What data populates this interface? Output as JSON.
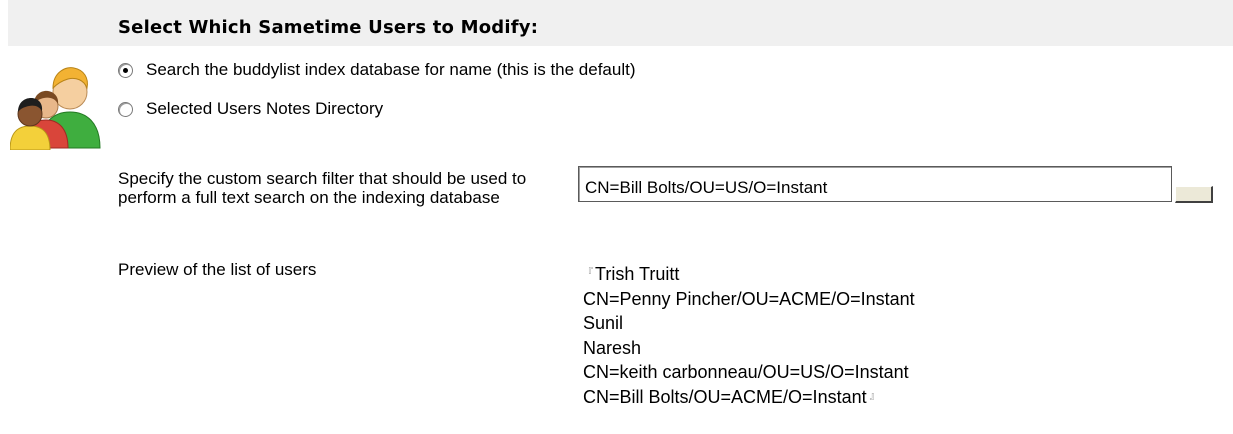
{
  "header": {
    "title": "Select Which Sametime Users to Modify:"
  },
  "radio_group": {
    "options": [
      {
        "label": "Search the buddylist index database for name (this is the default)",
        "checked": true
      },
      {
        "label": "Selected Users Notes Directory",
        "checked": false
      }
    ]
  },
  "filter": {
    "label": "Specify the custom search filter that should be used to perform a full text search on the indexing database",
    "value": "CN=Bill Bolts/OU=US/O=Instant"
  },
  "preview": {
    "label": "Preview of the list of users",
    "users": [
      "Trish Truitt",
      "CN=Penny Pincher/OU=ACME/O=Instant",
      "Sunil",
      "Naresh",
      "CN=keith carbonneau/OU=US/O=Instant",
      "CN=Bill Bolts/OU=ACME/O=Instant"
    ]
  },
  "colors": {
    "header_background": "#f0f0f0",
    "button_face": "#ece9d8"
  },
  "icons": {
    "users": "users-group-icon",
    "field_start": "field-start-corner-icon",
    "field_end": "field-end-corner-icon"
  }
}
